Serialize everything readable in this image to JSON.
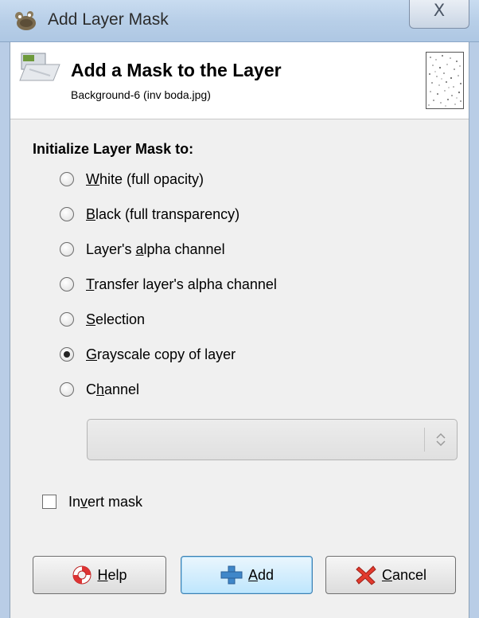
{
  "window": {
    "title": "Add Layer Mask",
    "close_glyph": "X"
  },
  "header": {
    "title": "Add a Mask to the Layer",
    "subtitle": "Background-6 (inv boda.jpg)",
    "icon": "layer-mask-icon"
  },
  "section": {
    "label": "Initialize Layer Mask to:"
  },
  "options": [
    {
      "pre": "",
      "mnemonic": "W",
      "post": "hite (full opacity)",
      "checked": false
    },
    {
      "pre": "",
      "mnemonic": "B",
      "post": "lack (full transparency)",
      "checked": false
    },
    {
      "pre": "Layer's ",
      "mnemonic": "a",
      "post": "lpha channel",
      "checked": false
    },
    {
      "pre": "",
      "mnemonic": "T",
      "post": "ransfer layer's alpha channel",
      "checked": false
    },
    {
      "pre": "",
      "mnemonic": "S",
      "post": "election",
      "checked": false
    },
    {
      "pre": "",
      "mnemonic": "G",
      "post": "rayscale copy of layer",
      "checked": true
    },
    {
      "pre": "C",
      "mnemonic": "h",
      "post": "annel",
      "checked": false
    }
  ],
  "channel_select": {
    "value": ""
  },
  "invert": {
    "pre": "In",
    "mnemonic": "v",
    "post": "ert mask",
    "checked": false
  },
  "buttons": {
    "help": {
      "mnemonic": "H",
      "post": "elp",
      "icon": "lifebuoy-icon"
    },
    "add": {
      "mnemonic": "A",
      "post": "dd",
      "icon": "plus-icon"
    },
    "cancel": {
      "mnemonic": "C",
      "post": "ancel",
      "icon": "cancel-x-icon"
    }
  },
  "colors": {
    "titlebar": "#b8cfe8",
    "default_button_border": "#3c7fb1"
  }
}
